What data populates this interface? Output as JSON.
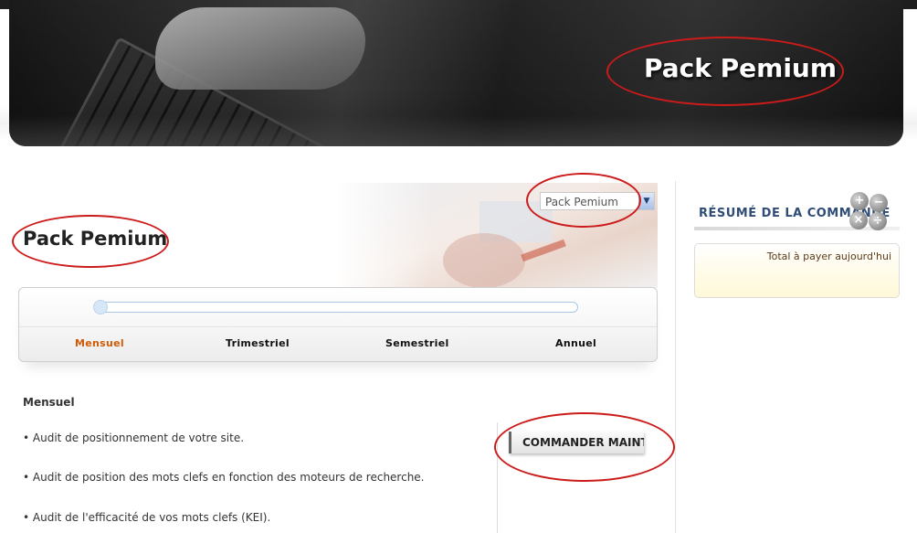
{
  "banner": {
    "title": "Pack Pemium"
  },
  "pack_select": {
    "value": "Pack Pemium"
  },
  "page": {
    "title": "Pack Pemium"
  },
  "billing_tabs": [
    {
      "label": "Mensuel",
      "active": true
    },
    {
      "label": "Trimestriel",
      "active": false
    },
    {
      "label": "Semestriel",
      "active": false
    },
    {
      "label": "Annuel",
      "active": false
    }
  ],
  "slider": {
    "position": 0
  },
  "details": {
    "title": "Mensuel",
    "bullets": [
      "• Audit de positionnement de votre site.",
      "• Audit de position des mots clefs en fonction des moteurs de recherche.",
      "• Audit de l'efficacité de vos mots clefs (KEI)."
    ]
  },
  "order_button": {
    "label": "COMMANDER MAINTENANT"
  },
  "summary": {
    "title": "RÉSUMÉ DE LA COMMANDE",
    "total_label": "Total à payer aujourd'hui",
    "icon": "calculator-icon"
  },
  "colors": {
    "accent_orange": "#d05a06",
    "heading_blue": "#2f4d77",
    "annotation_red": "#cc1b1b"
  }
}
